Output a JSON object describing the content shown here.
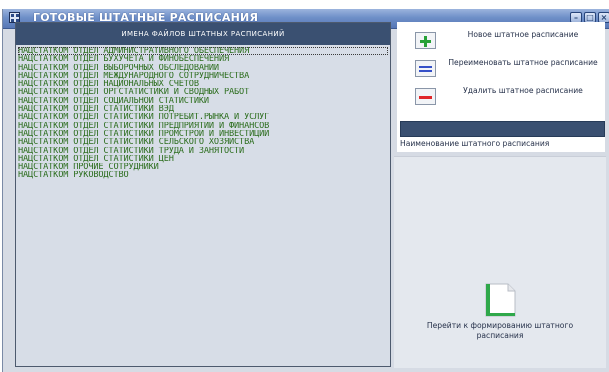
{
  "window": {
    "title": "ГОТОВЫЕ ШТАТНЫЕ РАСПИСАНИЯ"
  },
  "list": {
    "header": "ИМЕНА ФАЙЛОВ ШТАТНЫХ РАСПИСАНИЙ",
    "items": [
      "НАЦСТАТКОМ ОТДЕЛ АДМИНИСТРАТИВНОГО ОБЕСПЕЧЕНИЯ",
      "НАЦСТАТКОМ ОТДЕЛ БУХУЧЕТА И ФИНОБЕСПЕЧЕНИЯ",
      "НАЦСТАТКОМ ОТДЕЛ ВЫБОРОЧНЫХ ОБСЛЕДОВАНИЙ",
      "НАЦСТАТКОМ ОТДЕЛ МЕЖДУНАРОДНОГО СОТРУДНИЧЕСТВА",
      "НАЦСТАТКОМ ОТДЕЛ НАЦИОНАЛЬНЫХ СЧЕТОВ",
      "НАЦСТАТКОМ ОТДЕЛ ОРГСТАТИСТИКИ И СВОДНЫХ РАБОТ",
      "НАЦСТАТКОМ ОТДЕЛ СОЦИАЛЬНОЙ СТАТИСТИКИ",
      "НАЦСТАТКОМ ОТДЕЛ СТАТИСТИКИ ВЭД",
      "НАЦСТАТКОМ ОТДЕЛ СТАТИСТИКИ ПОТРЕБИТ.РЫНКА И УСЛУГ",
      "НАЦСТАТКОМ ОТДЕЛ СТАТИСТИКИ ПРЕДПРИЯТИЙ И ФИНАНСОВ",
      "НАЦСТАТКОМ ОТДЕЛ СТАТИСТИКИ ПРОМСТРОЙ И ИНВЕСТИЦИЙ",
      "НАЦСТАТКОМ ОТДЕЛ СТАТИСТИКИ СЕЛЬСКОГО ХОЗЯЙСТВА",
      "НАЦСТАТКОМ ОТДЕЛ СТАТИСТИКИ ТРУДА И ЗАНЯТОСТИ",
      "НАЦСТАТКОМ ОТДЕЛ СТАТИСТИКИ ЦЕН",
      "НАЦСТАТКОМ ПРОЧИЕ СОТРУДНИКИ",
      "НАЦСТАТКОМ РУКОВОДСТВО"
    ],
    "selected_index": 0
  },
  "actions": {
    "new_label": "Новое штатное расписание",
    "rename_label": "Переименовать штатное расписание",
    "delete_label": "Удалить штатное расписание"
  },
  "name_field": {
    "label": "Наименование штатного расписания",
    "value": ""
  },
  "goto": {
    "label": "Перейти к формированию штатного расписания"
  },
  "icons": {
    "app": "app-grid-icon",
    "add": "plus-icon",
    "rename": "equals-icon",
    "delete": "minus-icon",
    "goto": "document-icon"
  },
  "colors": {
    "header_bg": "#3a5071",
    "list_text": "#2d6e1f",
    "add": "#27a137",
    "rename": "#3550c8",
    "delete": "#e0262a"
  }
}
